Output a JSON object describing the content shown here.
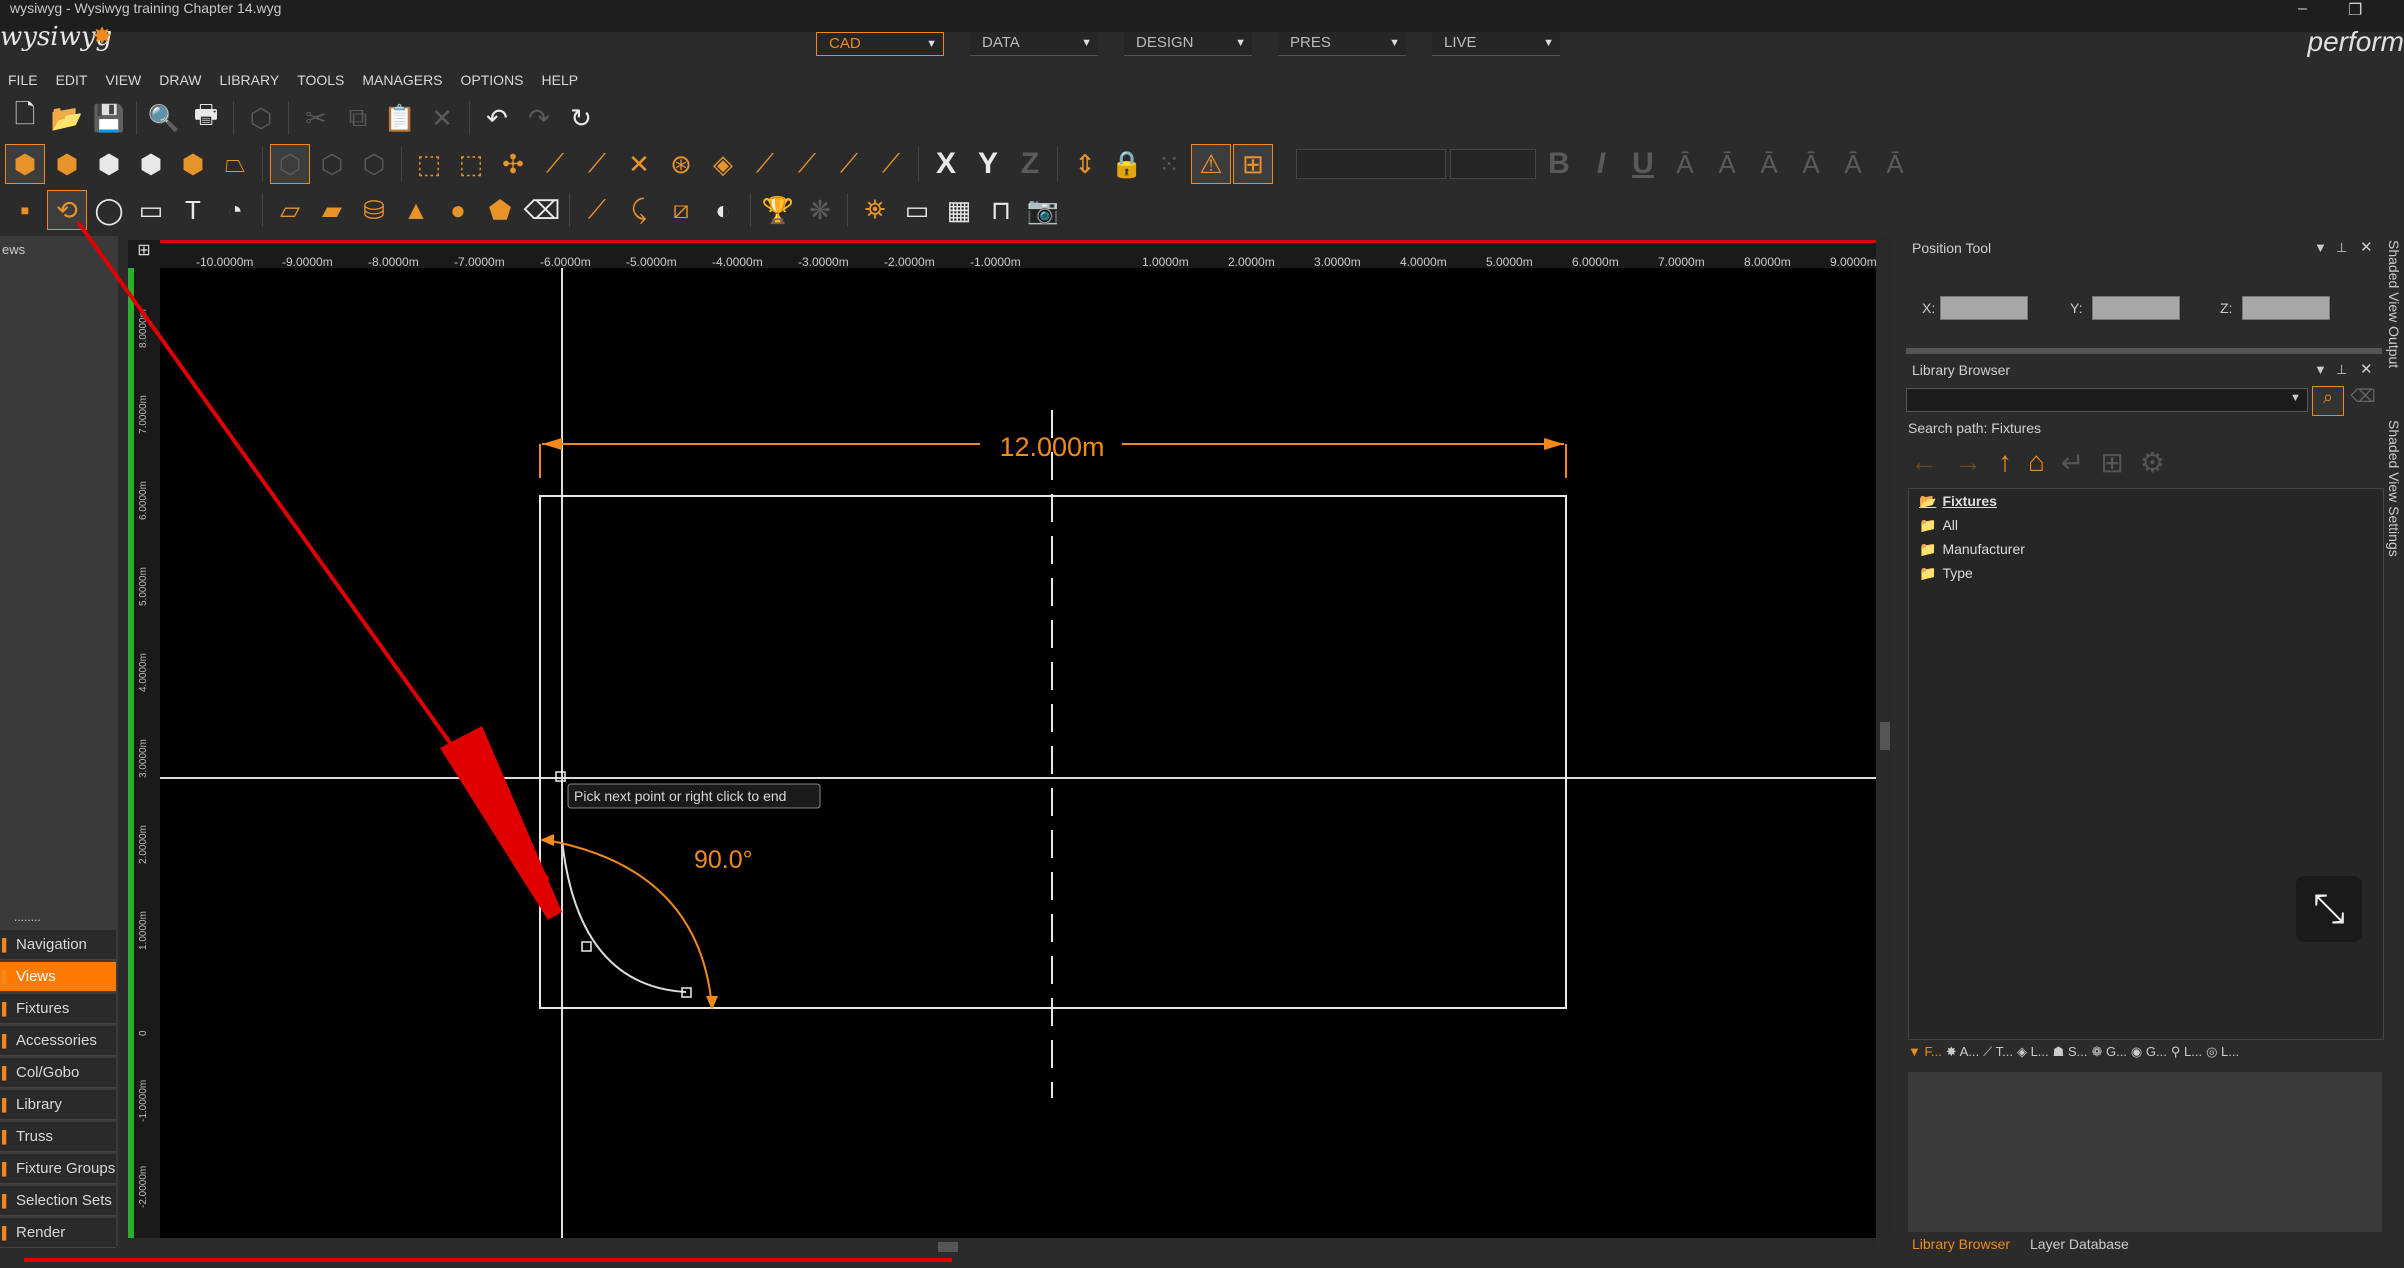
{
  "window": {
    "title": "wysiwyg - Wysiwyg training Chapter 14.wyg",
    "logo": "wysiwyg",
    "brand": "perform"
  },
  "modes": [
    {
      "label": "CAD",
      "active": true
    },
    {
      "label": "DATA",
      "active": false
    },
    {
      "label": "DESIGN",
      "active": false
    },
    {
      "label": "PRES",
      "active": false
    },
    {
      "label": "LIVE",
      "active": false
    }
  ],
  "menu": [
    "FILE",
    "EDIT",
    "VIEW",
    "DRAW",
    "LIBRARY",
    "TOOLS",
    "MANAGERS",
    "OPTIONS",
    "HELP"
  ],
  "toolbar": {
    "axis_x": "X",
    "axis_y": "Y",
    "axis_z": "Z",
    "bold": "B",
    "italic": "I",
    "underline": "U"
  },
  "left_panel": {
    "header": "ews",
    "grip": "........",
    "items": [
      {
        "label": "Navigation",
        "active": false
      },
      {
        "label": "Views",
        "active": true
      },
      {
        "label": "Fixtures",
        "active": false
      },
      {
        "label": "Accessories",
        "active": false
      },
      {
        "label": "Col/Gobo",
        "active": false
      },
      {
        "label": "Library",
        "active": false
      },
      {
        "label": "Truss",
        "active": false
      },
      {
        "label": "Fixture Groups",
        "active": false
      },
      {
        "label": "Selection Sets",
        "active": false
      },
      {
        "label": "Render",
        "active": false
      }
    ]
  },
  "ruler": {
    "h_labels": [
      "-10.0000m",
      "-9.0000m",
      "-8.0000m",
      "-7.0000m",
      "-6.0000m",
      "-5.0000m",
      "-4.0000m",
      "-3.0000m",
      "-2.0000m",
      "-1.0000m",
      "1.0000m",
      "2.0000m",
      "3.0000m",
      "4.0000m",
      "5.0000m",
      "6.0000m",
      "7.0000m",
      "8.0000m",
      "9.0000m"
    ],
    "v_labels": [
      "8.0000m",
      "7.0000m",
      "6.0000m",
      "5.0000m",
      "4.0000m",
      "3.0000m",
      "2.0000m",
      "1.0000m",
      "0",
      "-1.0000m",
      "-2.0000m"
    ]
  },
  "canvas": {
    "dimension_label": "12.000m",
    "angle_label": "90.0°",
    "tooltip": "Pick next point or right click to end"
  },
  "position_tool": {
    "title": "Position Tool",
    "x_label": "X:",
    "y_label": "Y:",
    "z_label": "Z:"
  },
  "library_browser": {
    "title": "Library Browser",
    "search_path": "Search path: Fixtures",
    "tree": [
      {
        "label": "Fixtures",
        "open": true
      },
      {
        "label": "All"
      },
      {
        "label": "Manufacturer"
      },
      {
        "label": "Type"
      }
    ],
    "tabs": [
      "F...",
      "A...",
      "T...",
      "L...",
      "S...",
      "G...",
      "G...",
      "L...",
      "L..."
    ],
    "bottom_tabs": [
      "Library Browser",
      "Layer Database"
    ]
  },
  "side_tabs": [
    "Shaded View Output",
    "Shaded View Settings"
  ],
  "colors": {
    "accent": "#f08a1c",
    "active_nav": "#ff7a00",
    "annotation_red": "#e00000"
  }
}
